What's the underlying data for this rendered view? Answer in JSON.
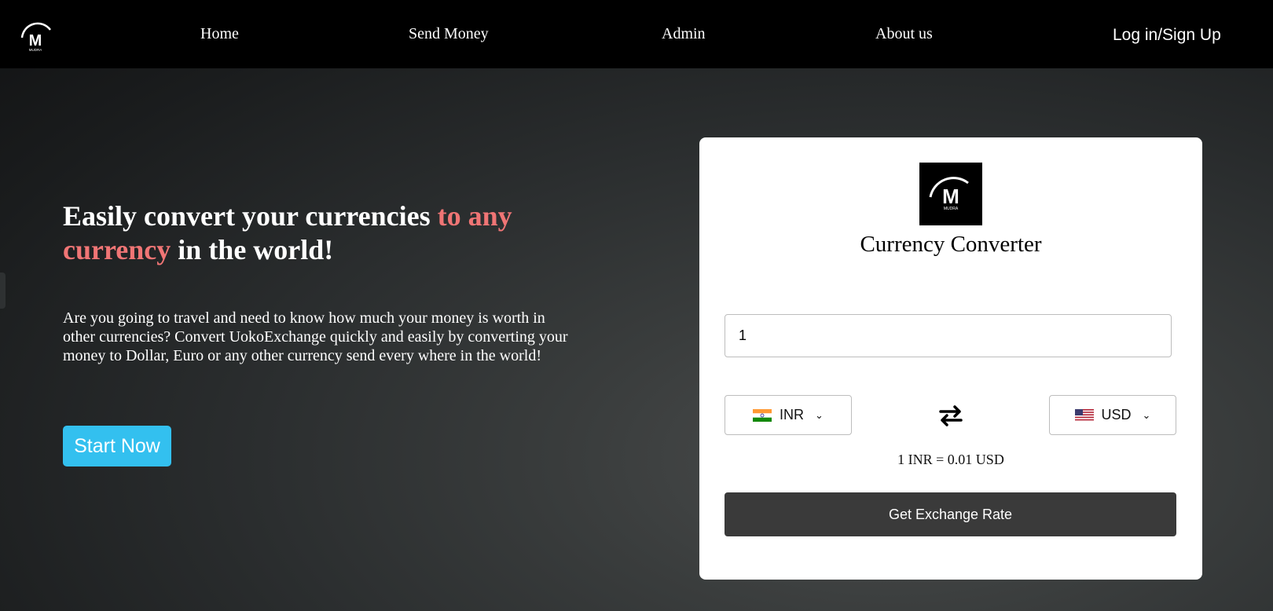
{
  "nav": {
    "logo_icon": "mudra-logo-icon",
    "home": "Home",
    "send_money": "Send Money",
    "admin": "Admin",
    "about": "About us",
    "login": "Log in/Sign Up"
  },
  "hero": {
    "title_part1": "Easily convert your currencies ",
    "title_accent": "to any currency",
    "title_part2": " in the world!",
    "description": "Are you going to travel and need to know how much your money is worth in other currencies? Convert UokoExchange quickly and easily by converting your money to Dollar, Euro or any other currency send every where in the world!",
    "start_button": "Start Now"
  },
  "converter": {
    "title": "Currency Converter",
    "amount_value": "1",
    "from_currency": "INR",
    "from_flag": "india-flag-icon",
    "to_currency": "USD",
    "to_flag": "us-flag-icon",
    "swap_icon": "swap-arrows-icon",
    "rate_text": "1 INR = 0.01 USD",
    "button_label": "Get Exchange Rate"
  },
  "colors": {
    "accent": "#f07575",
    "start_button": "#33c0ef",
    "rate_button": "#3a3a3a",
    "topbar": "#000000"
  }
}
